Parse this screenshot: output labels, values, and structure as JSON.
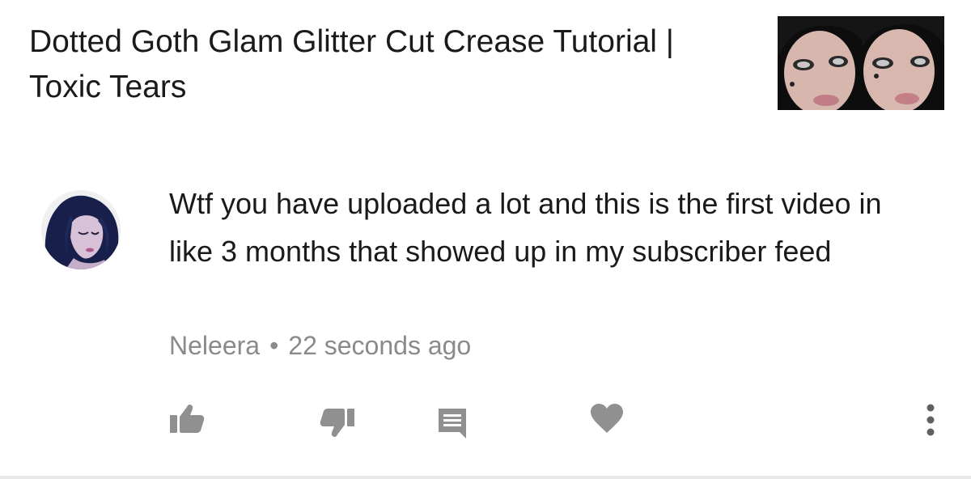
{
  "video": {
    "title": "Dotted Goth Glam Glitter Cut Crease Tutorial | Toxic Tears",
    "thumbnail_icon": "thumbnail-image"
  },
  "comment": {
    "text": "Wtf you have uploaded a lot and this is the first video in like 3 months that showed up in my subscriber feed",
    "author": "Neleera",
    "separator": "•",
    "time": "22 seconds ago",
    "avatar_icon": "avatar-image"
  },
  "actions": {
    "like_icon": "thumbs-up-icon",
    "dislike_icon": "thumbs-down-icon",
    "reply_icon": "comment-icon",
    "heart_icon": "heart-icon",
    "more_icon": "more-vertical-icon"
  },
  "colors": {
    "text": "#1a1a1a",
    "meta": "#8a8a8a",
    "icon": "#909090",
    "background": "#ffffff"
  }
}
